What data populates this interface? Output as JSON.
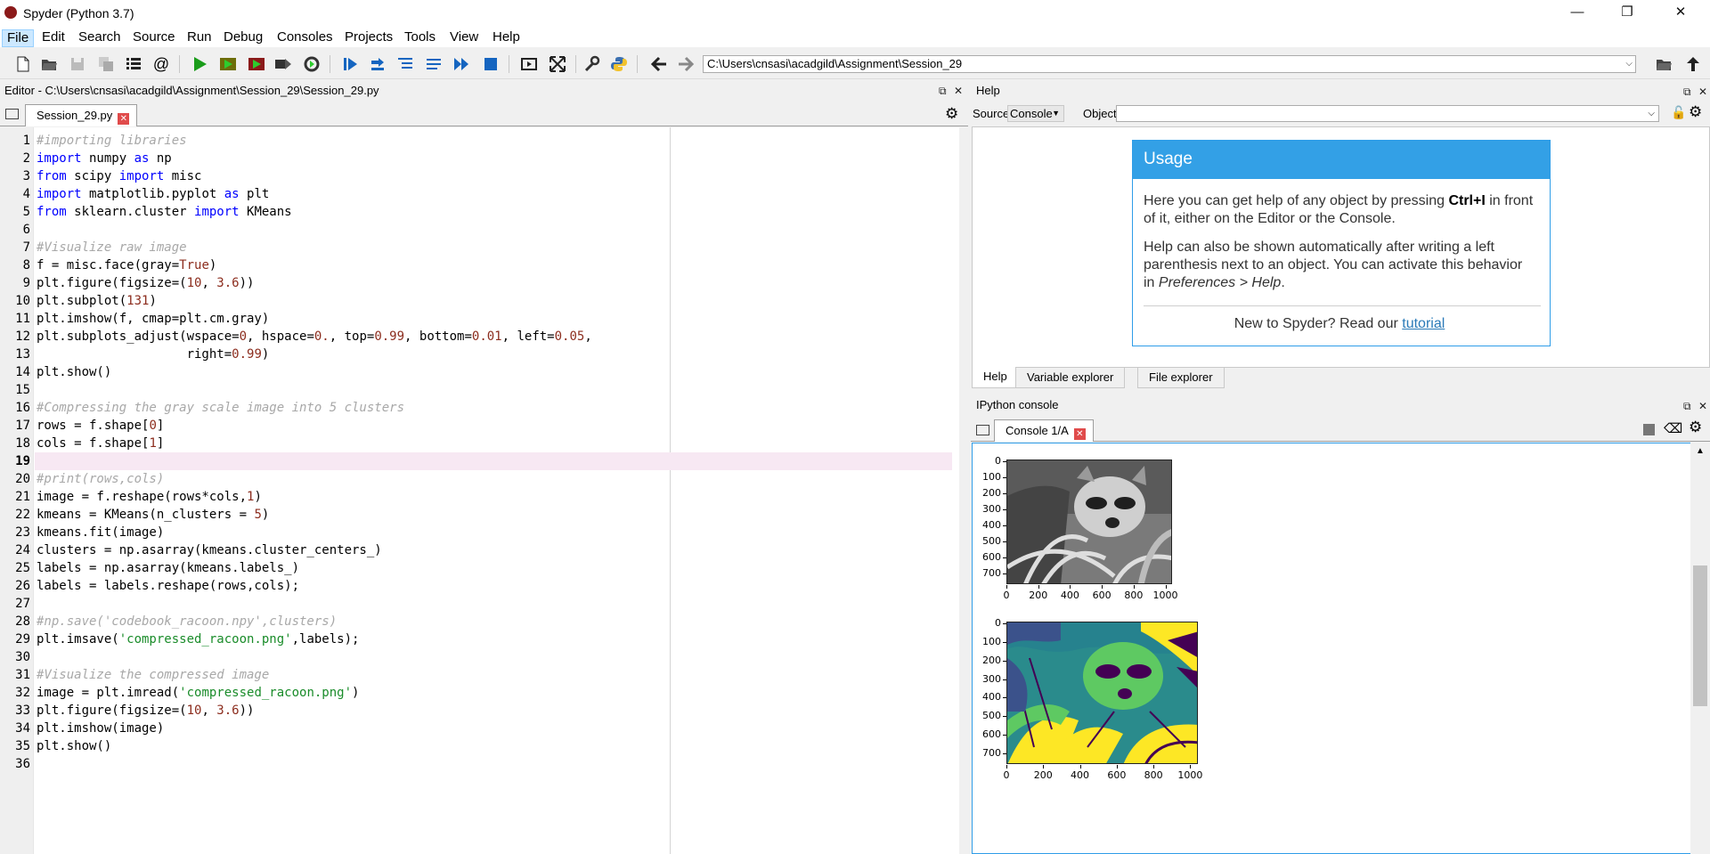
{
  "window": {
    "title": "Spyder (Python 3.7)",
    "minimize": "—",
    "restore": "❐",
    "close": "✕"
  },
  "menu": [
    "File",
    "Edit",
    "Search",
    "Source",
    "Run",
    "Debug",
    "Consoles",
    "Projects",
    "Tools",
    "View",
    "Help"
  ],
  "toolbar": {
    "path": "C:\\Users\\cnsasi\\acadgild\\Assignment\\Session_29",
    "icons": [
      "new-file-icon",
      "open-file-icon",
      "save-icon",
      "save-all-icon",
      "browse-tabs-icon",
      "at-icon",
      "run-icon",
      "run-cell-icon",
      "run-cell-advance-icon",
      "run-selection-icon",
      "rerun-icon",
      "debug-icon",
      "step-icon",
      "step-into-icon",
      "step-return-icon",
      "continue-icon",
      "stop-icon",
      "maximize-pane-icon",
      "fullscreen-icon",
      "preferences-icon",
      "python-path-icon",
      "back-icon",
      "forward-icon",
      "browse-folder-icon",
      "parent-dir-icon"
    ]
  },
  "editor": {
    "header": "Editor - C:\\Users\\cnsasi\\acadgild\\Assignment\\Session_29\\Session_29.py",
    "tab": "Session_29.py",
    "current_line": 19,
    "lines": [
      "#importing libraries",
      "import numpy as np",
      "from scipy import misc",
      "import matplotlib.pyplot as plt",
      "from sklearn.cluster import KMeans",
      "",
      "#Visualize raw image",
      "f = misc.face(gray=True)",
      "plt.figure(figsize=(10, 3.6))",
      "plt.subplot(131)",
      "plt.imshow(f, cmap=plt.cm.gray)",
      "plt.subplots_adjust(wspace=0, hspace=0., top=0.99, bottom=0.01, left=0.05,",
      "                    right=0.99)",
      "plt.show()",
      "",
      "#Compressing the gray scale image into 5 clusters",
      "rows = f.shape[0]",
      "cols = f.shape[1]",
      "",
      "#print(rows,cols)",
      "image = f.reshape(rows*cols,1)",
      "kmeans = KMeans(n_clusters = 5)",
      "kmeans.fit(image)",
      "clusters = np.asarray(kmeans.cluster_centers_)",
      "labels = np.asarray(kmeans.labels_)",
      "labels = labels.reshape(rows,cols);",
      "",
      "#np.save('codebook_racoon.npy',clusters)",
      "plt.imsave('compressed_racoon.png',labels);",
      "",
      "#Visualize the compressed image",
      "image = plt.imread('compressed_racoon.png')",
      "plt.figure(figsize=(10, 3.6))",
      "plt.imshow(image)",
      "plt.show()",
      ""
    ]
  },
  "help": {
    "header": "Help",
    "source_label": "Source",
    "source_value": "Console",
    "object_label": "Object",
    "object_value": "",
    "usage_title": "Usage",
    "p1_pre": "Here you can get help of any object by pressing ",
    "p1_key": "Ctrl+I",
    "p1_post": " in front of it, either on the Editor or the Console.",
    "p2_pre": "Help can also be shown automatically after writing a left parenthesis next to an object. You can activate this behavior in ",
    "p2_em": "Preferences > Help",
    "p2_post": ".",
    "new_pre": "New to Spyder? Read our ",
    "new_link": "tutorial",
    "tabs": [
      "Help",
      "Variable explorer",
      "File explorer"
    ]
  },
  "ipython": {
    "header": "IPython console",
    "tab": "Console 1/A",
    "plot1": {
      "yticks": [
        "0",
        "100",
        "200",
        "300",
        "400",
        "500",
        "600",
        "700"
      ],
      "xticks": [
        "0",
        "200",
        "400",
        "600",
        "800",
        "1000"
      ]
    },
    "plot2": {
      "yticks": [
        "0",
        "100",
        "200",
        "300",
        "400",
        "500",
        "600",
        "700"
      ],
      "xticks": [
        "0",
        "200",
        "400",
        "600",
        "800",
        "1000"
      ]
    }
  }
}
